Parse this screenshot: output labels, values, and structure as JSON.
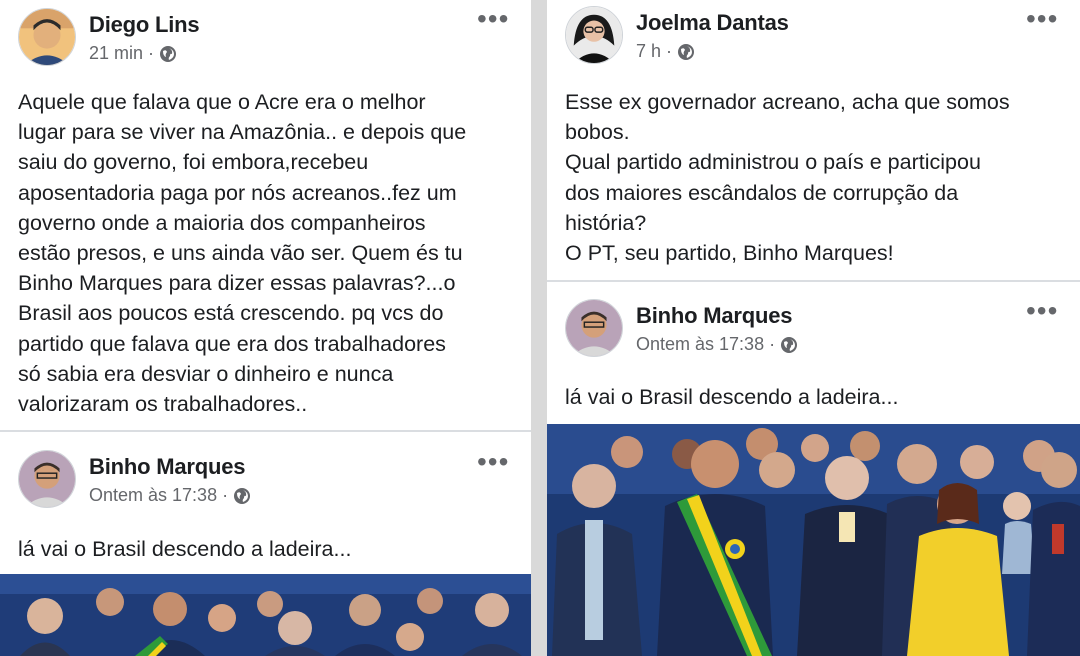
{
  "left_column": {
    "post1": {
      "author": "Diego Lins",
      "time": "21 min",
      "separator": "·",
      "visibility_icon": "globe-icon",
      "more_icon": "•••",
      "text": "Aquele que falava que o Acre era o melhor\nlugar para se viver na Amazônia.. e depois que\nsaiu do governo, foi embora,recebeu\naposentadoria paga por nós acreanos..fez um\ngoverno onde a maioria dos companheiros\nestão presos, e uns ainda vão ser. Quem és tu\nBinho Marques para dizer essas palavras?...o\nBrasil aos poucos está crescendo. pq vcs do\npartido que falava que era dos trabalhadores\nsó sabia era desviar o dinheiro e nunca\nvalorizaram os trabalhadores.."
    },
    "post2": {
      "author": "Binho Marques",
      "time": "Ontem às 17:38",
      "separator": "·",
      "visibility_icon": "globe-icon",
      "more_icon": "•••",
      "text": "lá vai o Brasil descendo a ladeira..."
    }
  },
  "right_column": {
    "post1": {
      "author": "Joelma Dantas",
      "time": "7 h",
      "separator": "·",
      "visibility_icon": "globe-icon",
      "more_icon": "•••",
      "text": "Esse ex governador acreano, acha que somos\nbobos.\nQual partido administrou o país e participou\ndos maiores escândalos de corrupção da\nhistória?\nO PT, seu partido, Binho Marques!"
    },
    "post2": {
      "author": "Binho Marques",
      "time": "Ontem às 17:38",
      "separator": "·",
      "visibility_icon": "globe-icon",
      "more_icon": "•••",
      "text": "lá vai o Brasil descendo a ladeira..."
    }
  },
  "colors": {
    "background": "#d9d9d9",
    "card": "#ffffff",
    "text": "#1c1e21",
    "secondary_text": "#65676b",
    "sash_green": "#2e9a3a",
    "sash_yellow": "#f2d21b",
    "yellow_dress": "#f2cf2a"
  }
}
